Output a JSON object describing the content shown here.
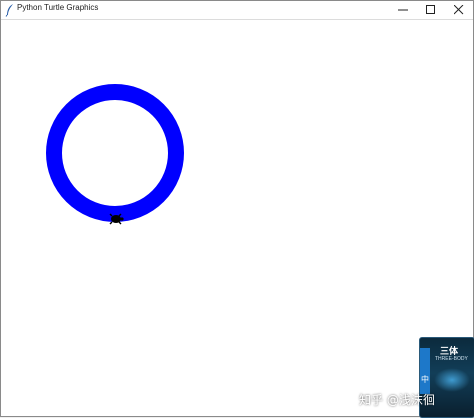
{
  "window": {
    "title": "Python Turtle Graphics",
    "icon": "feather-icon",
    "controls": {
      "minimize_icon": "minimize-icon",
      "maximize_icon": "maximize-icon",
      "close_icon": "close-icon"
    }
  },
  "canvas": {
    "drawing": {
      "shape": "ring",
      "ring_color": "#0000ff",
      "turtle_color": "#000000",
      "turtle_icon": "turtle-icon"
    }
  },
  "watermark": {
    "text": "知乎 @浅沫徊",
    "thumb_title": "三体",
    "thumb_subtitle": "THREE-BODY",
    "thumb_side": "中",
    "colors": {
      "bg": "#123e58",
      "badge": "#1d78c9"
    }
  }
}
